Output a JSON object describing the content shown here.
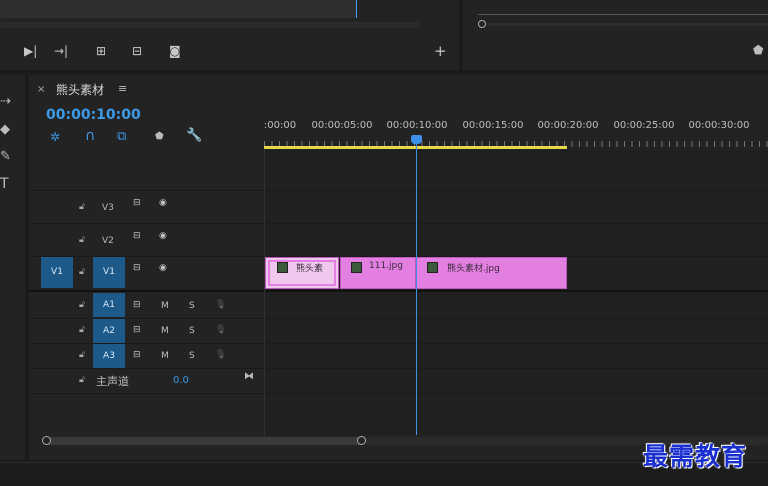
{
  "panel": {
    "tab_title": "熊头素材",
    "timecode": "00:00:10:00"
  },
  "ruler": {
    "labels": [
      ":00:00",
      "00:00:05:00",
      "00:00:10:00",
      "00:00:15:00",
      "00:00:20:00",
      "00:00:25:00",
      "00:00:30:00"
    ]
  },
  "tracks": {
    "video": [
      {
        "name": "V3"
      },
      {
        "name": "V2"
      },
      {
        "name": "V1",
        "source": "V1"
      }
    ],
    "audio": [
      {
        "name": "A1",
        "m": "M",
        "s": "S"
      },
      {
        "name": "A2",
        "m": "M",
        "s": "S"
      },
      {
        "name": "A3",
        "m": "M",
        "s": "S"
      }
    ],
    "master": {
      "label": "主声道",
      "value": "0.0"
    }
  },
  "clips": [
    {
      "name": "熊头素"
    },
    {
      "name": "111.jpg"
    },
    {
      "name": "熊头素材.jpg"
    }
  ],
  "icons": {
    "playhead_color": "#4a9eff",
    "clip_color": "#e37fe0",
    "work_area_color": "#e8d94a"
  },
  "watermark": "最需教育"
}
